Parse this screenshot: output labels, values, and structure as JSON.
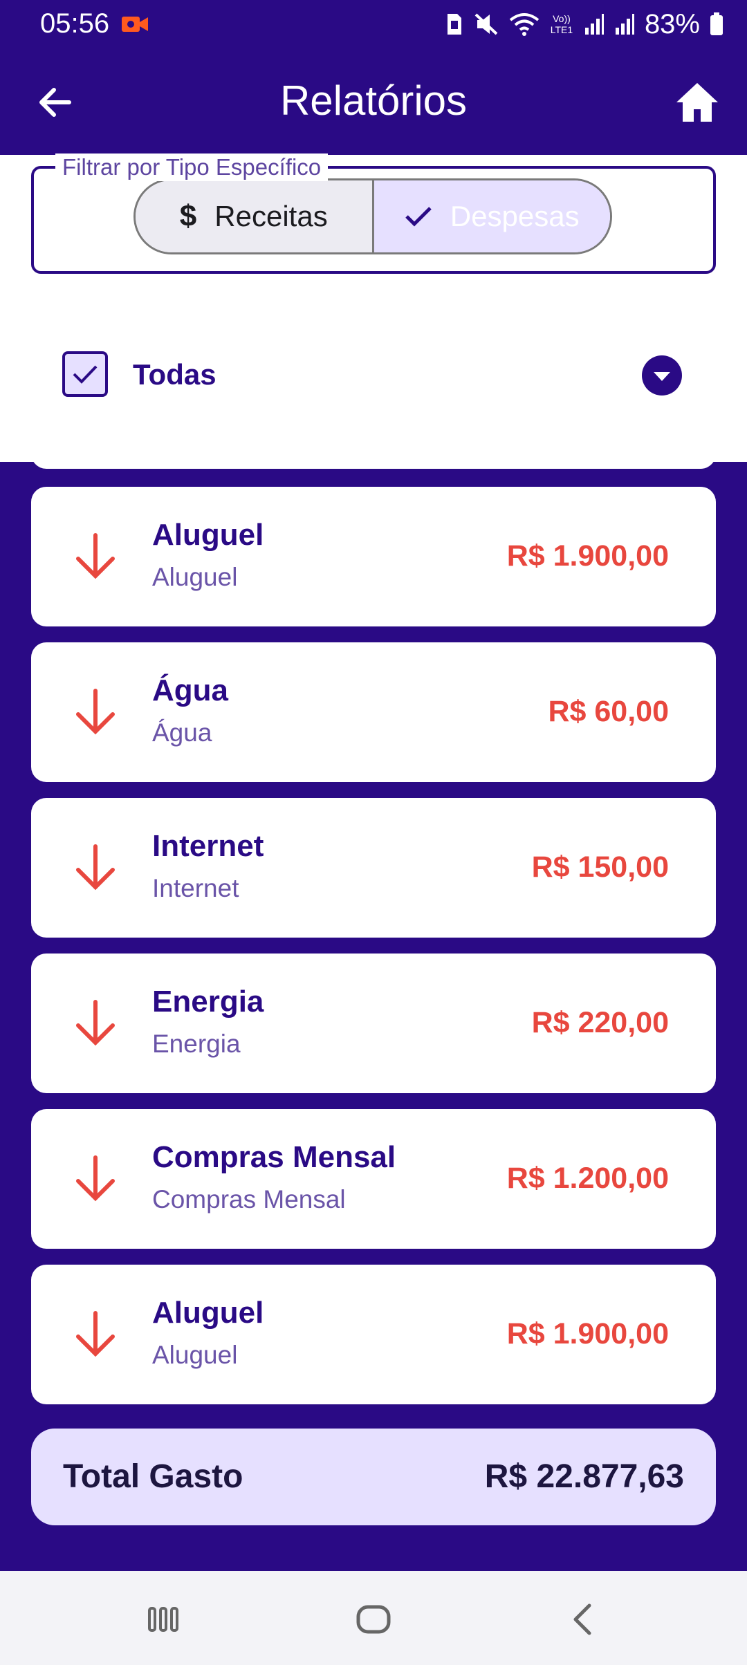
{
  "status_bar": {
    "time": "05:56",
    "battery_text": "83%",
    "volte_label": "Vo)) LTE1"
  },
  "app_bar": {
    "title": "Relatórios"
  },
  "segmented": {
    "income_label": "Receitas",
    "income_icon": "$",
    "expense_label": "Despesas",
    "selected": "Despesas"
  },
  "filter": {
    "label": "Filtrar por Tipo Específico",
    "value": "Todas"
  },
  "transactions": [
    {
      "title": "Aluguel",
      "subtitle": "Aluguel",
      "amount": "R$ 1.900,00"
    },
    {
      "title": "Água",
      "subtitle": "Água",
      "amount": "R$ 60,00"
    },
    {
      "title": "Internet",
      "subtitle": "Internet",
      "amount": "R$ 150,00"
    },
    {
      "title": "Energia",
      "subtitle": "Energia",
      "amount": "R$ 220,00"
    },
    {
      "title": "Compras Mensal",
      "subtitle": "Compras Mensal",
      "amount": "R$ 1.200,00"
    },
    {
      "title": "Aluguel",
      "subtitle": "Aluguel",
      "amount": "R$ 1.900,00"
    }
  ],
  "total": {
    "label": "Total Gasto",
    "value": "R$ 22.877,63"
  },
  "colors": {
    "primary": "#2a0a85",
    "expense_red": "#e8473e",
    "selected_bg": "#e6e0ff"
  }
}
